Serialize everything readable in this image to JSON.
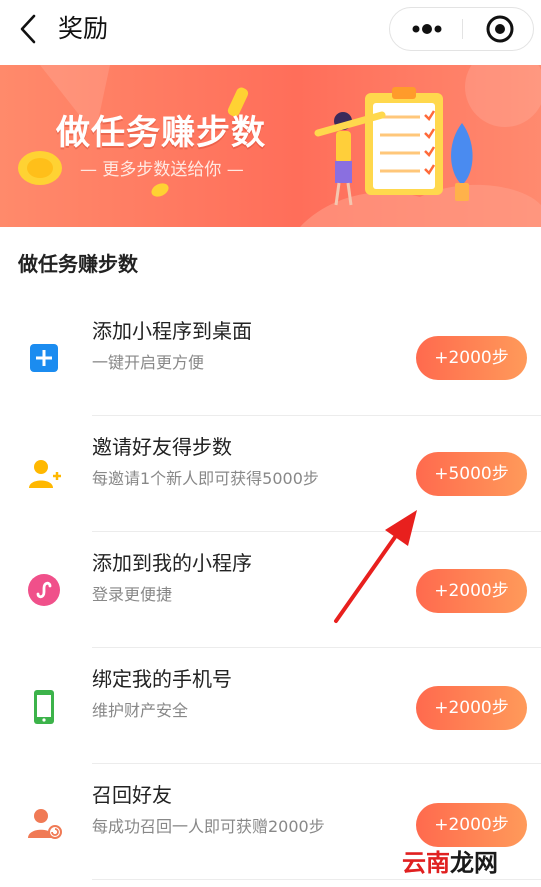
{
  "nav": {
    "title": "奖励"
  },
  "banner": {
    "title": "做任务赚步数",
    "subtitle": "— 更多步数送给你 —"
  },
  "section": {
    "title": "做任务赚步数"
  },
  "tasks": [
    {
      "label": "添加小程序到桌面",
      "desc": "一键开启更方便",
      "reward": "+2000步",
      "icon": "add-square-icon"
    },
    {
      "label": "邀请好友得步数",
      "desc": "每邀请1个新人即可获得5000步",
      "reward": "+5000步",
      "icon": "add-user-icon"
    },
    {
      "label": "添加到我的小程序",
      "desc": "登录更便捷",
      "reward": "+2000步",
      "icon": "mini-program-icon"
    },
    {
      "label": "绑定我的手机号",
      "desc": "维护财产安全",
      "reward": "+2000步",
      "icon": "phone-icon"
    },
    {
      "label": "召回好友",
      "desc": "每成功召回一人即可获赠2000步",
      "reward": "+2000步",
      "icon": "recall-user-icon"
    }
  ],
  "watermark": {
    "a": "云南",
    "b": "龙网"
  },
  "colors": {
    "accent": "#ff7a55",
    "banner": "#ff7a62",
    "annotation_arrow": "#e8201e"
  }
}
